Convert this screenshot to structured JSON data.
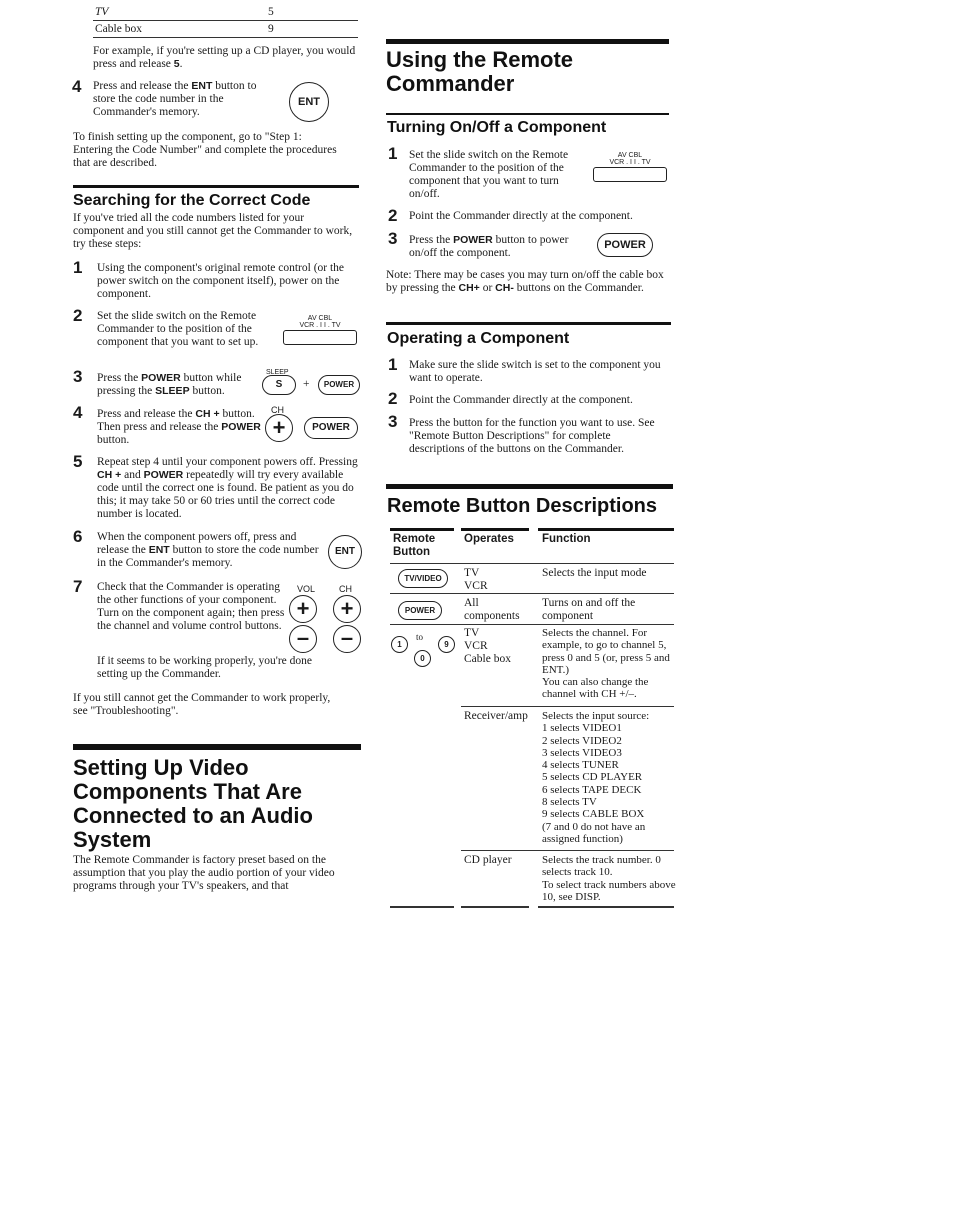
{
  "left": {
    "code_table": [
      {
        "component": "TV",
        "code": "5"
      },
      {
        "component": "Cable box",
        "code": "9"
      }
    ],
    "example": [
      "For example, if you're setting up a CD player, you would press and release ",
      "5",
      "."
    ],
    "step4": {
      "n": "4",
      "t1": "Press and release the ",
      "b1": "ENT",
      "t2": " button to store the code number in the Commander's memory.",
      "icon": "ENT"
    },
    "finish": "To finish setting up the component, go to \"Step 1: Entering the Code Number\" and complete the procedures that are described.",
    "search": {
      "heading": "Searching for the Correct Code",
      "intro": "If you've tried all the code numbers listed for your component and you still cannot get the Commander to work, try these steps:",
      "s1": {
        "n": "1",
        "t": "Using the component's original remote control (or the power switch on the component itself), power on the component."
      },
      "s2": {
        "n": "2",
        "t": "Set the slide switch on the Remote Commander to the position of the component that you want to set up.",
        "switch_top": "AV CBL",
        "switch_bottom": "VCR . I I . TV"
      },
      "s3": {
        "n": "3",
        "t1": "Press the ",
        "b1": "POWER",
        "t2": " button while pressing the ",
        "b2": "SLEEP",
        "t3": " button.",
        "sleep": "SLEEP",
        "s": "S",
        "plus": "+",
        "power": "POWER"
      },
      "s4": {
        "n": "4",
        "t1": "Press and release the ",
        "b1": "CH +",
        "t2": " button. Then press and release the ",
        "b2": "POWER",
        "t3": " button.",
        "ch": "CH",
        "power": "POWER"
      },
      "s5": {
        "n": "5",
        "t1": "Repeat step 4 until your component powers off. Pressing ",
        "b1": "CH +",
        "t2": " and ",
        "b2": "POWER",
        "t3": " repeatedly will try every available code until the correct one is found. Be patient as you do this; it may take 50 or 60 tries until the correct code number is located."
      },
      "s6": {
        "n": "6",
        "t1": "When the component powers off, press and release the ",
        "b1": "ENT",
        "t2": " button to store the code number in the Commander's memory.",
        "icon": "ENT"
      },
      "s7": {
        "n": "7",
        "t1": "Check that the Commander is operating the other functions of your component. Turn on the component again; then press the channel and volume control buttons.",
        "t2": "If it seems to be working properly, you're done setting up the Commander.",
        "vol": "VOL",
        "ch": "CH"
      },
      "outro": "If you still cannot get the Commander to work properly, see \"Troubleshooting\"."
    },
    "audio": {
      "heading": "Setting Up Video Components That Are Connected to an Audio System",
      "text": "The Remote Commander is factory preset based on the assumption that you play the audio portion of your video programs through your TV's speakers, and that"
    }
  },
  "right": {
    "heading": "Using the Remote Commander",
    "onoff": {
      "heading": "Turning On/Off a Component",
      "s1": {
        "n": "1",
        "t": "Set the slide switch on the Remote Commander to the position of the component that you want to turn on/off."
      },
      "s2": {
        "n": "2",
        "t": "Point the Commander directly at the component."
      },
      "s3": {
        "n": "3",
        "t1": "Press the ",
        "b1": "POWER",
        "t2": " button to power on/off the component.",
        "icon": "POWER"
      },
      "note": {
        "t1": "Note: There may be cases you may turn on/off the cable box by pressing the ",
        "b1": "CH+",
        "t2": " or ",
        "b2": "CH-",
        "t3": " buttons on the Commander."
      }
    },
    "operating": {
      "heading": "Operating a Component",
      "s1": {
        "n": "1",
        "t": "Make sure the slide switch is set to the component you want to operate."
      },
      "s2": {
        "n": "2",
        "t": "Point the Commander directly at the component."
      },
      "s3": {
        "n": "3",
        "t": "Press the button for the function you want to use. See \"Remote Button Descriptions\" for complete descriptions of the buttons on the Commander."
      }
    },
    "descriptions": {
      "heading": "Remote Button Descriptions",
      "columns": [
        "Remote Button",
        "Operates",
        "Function"
      ],
      "rows": [
        {
          "button": "TV/VIDEO",
          "operates": "TV\nVCR",
          "function": "Selects the input mode"
        },
        {
          "button": "POWER",
          "operates": "All components",
          "function": "Turns on and off the component"
        },
        {
          "button": "1 to 9 0",
          "operates": "TV\nVCR\nCable box",
          "function": "Selects the channel. For example, to go to channel 5, press 0 and 5 (or, press 5 and ENT.)\nYou can also change the channel with CH +/–."
        },
        {
          "button": "",
          "operates": "Receiver/amp",
          "function": "Selects the input source:\n1 selects VIDEO1\n2 selects VIDEO2\n3 selects VIDEO3\n4 selects TUNER\n5 selects CD PLAYER\n6 selects TAPE DECK\n8 selects TV\n9 selects CABLE BOX\n(7 and 0 do not have an assigned function)"
        },
        {
          "button": "",
          "operates": "CD player",
          "function": "Selects the track number. 0 selects track 10.\nTo select track numbers above 10, see DISP."
        }
      ],
      "keys": {
        "one": "1",
        "to": "to",
        "nine": "9",
        "zero": "0"
      }
    }
  }
}
